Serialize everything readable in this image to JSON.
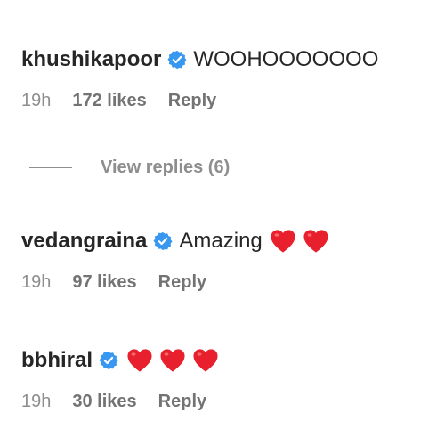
{
  "comments": [
    {
      "username": "khushikapoor",
      "verified": true,
      "text": "WOOHOOOOOOO",
      "hearts": 0,
      "time": "19h",
      "likes": "172 likes",
      "reply_label": "Reply"
    },
    {
      "username": "vedangraina",
      "verified": true,
      "text": "Amazing",
      "hearts": 2,
      "time": "19h",
      "likes": "97 likes",
      "reply_label": "Reply"
    },
    {
      "username": "bbhiral",
      "verified": true,
      "text": "",
      "hearts": 3,
      "time": "19h",
      "likes": "30 likes",
      "reply_label": "Reply"
    }
  ],
  "view_replies": {
    "label": "View replies (6)"
  },
  "colors": {
    "verified_badge": "#3897f0",
    "heart": "#e8202e",
    "meta_text": "#737373"
  },
  "icons": {
    "verified": "verified-badge-icon",
    "heart": "red-heart-emoji"
  }
}
